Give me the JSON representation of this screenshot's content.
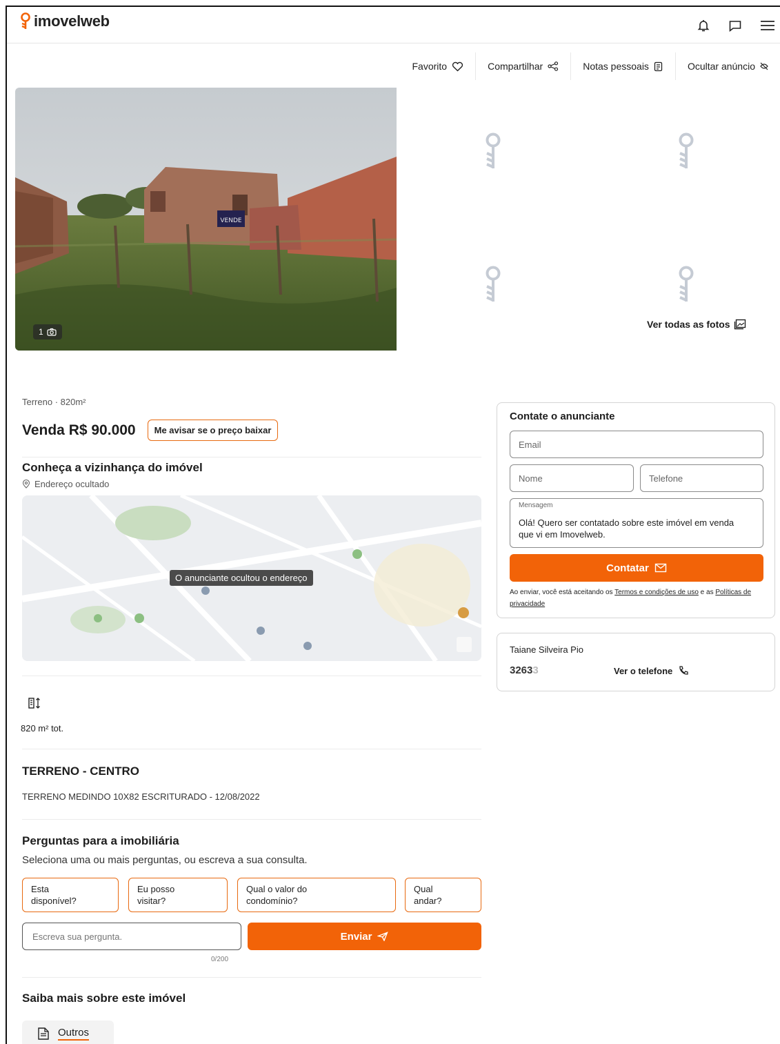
{
  "header": {
    "logo_text": "imovelweb",
    "icons": [
      "bell-icon",
      "chat-icon",
      "menu-icon"
    ]
  },
  "actions": [
    {
      "label": "Favorito",
      "icon": "heart-icon"
    },
    {
      "label": "Compartilhar",
      "icon": "share-icon"
    },
    {
      "label": "Notas pessoais",
      "icon": "notes-icon"
    },
    {
      "label": "Ocultar anúncio",
      "icon": "hide-icon"
    }
  ],
  "gallery": {
    "photo_count": "1",
    "see_all_label": "Ver todas as fotos"
  },
  "listing": {
    "type_area": "Terreno · 820m²",
    "price": "Venda R$ 90.000",
    "price_alert_label": "Me avisar se o preço baixar"
  },
  "neighborhood": {
    "title": "Conheça a vizinhança do imóvel",
    "address": "Endereço ocultado",
    "map_label": "O anunciante ocultou o endereço"
  },
  "features": {
    "area_total": "820 m² tot."
  },
  "description": {
    "title": "TERRENO - CENTRO",
    "text": "TERRENO MEDINDO 10X82 ESCRITURADO - 12/08/2022"
  },
  "questions": {
    "title": "Perguntas para a imobiliária",
    "subtitle": "Seleciona uma ou mais perguntas, ou escreva a sua consulta.",
    "chips": [
      {
        "line1": "Esta",
        "line2": "disponível?"
      },
      {
        "line1": "Eu posso",
        "line2": "visitar?"
      },
      {
        "line1": "Qual o valor do",
        "line2": "condomínio?"
      },
      {
        "line1": "Qual",
        "line2": "andar?"
      }
    ],
    "input_placeholder": "Escreva sua pergunta.",
    "counter": "0/200",
    "send_label": "Enviar"
  },
  "more": {
    "title": "Saiba mais sobre este imóvel",
    "tab_label": "Outros"
  },
  "contact": {
    "title": "Contate o anunciante",
    "email_placeholder": "Email",
    "name_placeholder": "Nome",
    "phone_placeholder": "Telefone",
    "message_label": "Mensagem",
    "message_text": "Olá! Quero ser contatado sobre este imóvel em venda que vi em Imovelweb.",
    "submit_label": "Contatar",
    "legal_prefix": "Ao enviar, você está aceitando os",
    "legal_terms": "Termos e condições de uso",
    "legal_middle": "e as",
    "legal_privacy": "Políticas de privacidade"
  },
  "agent": {
    "name": "Taiane Silveira Pio",
    "phone_partial": "3263",
    "phone_faded": "3",
    "see_phone_label": "Ver o telefone"
  },
  "colors": {
    "accent": "#f26308",
    "border_accent": "#e8690f"
  }
}
